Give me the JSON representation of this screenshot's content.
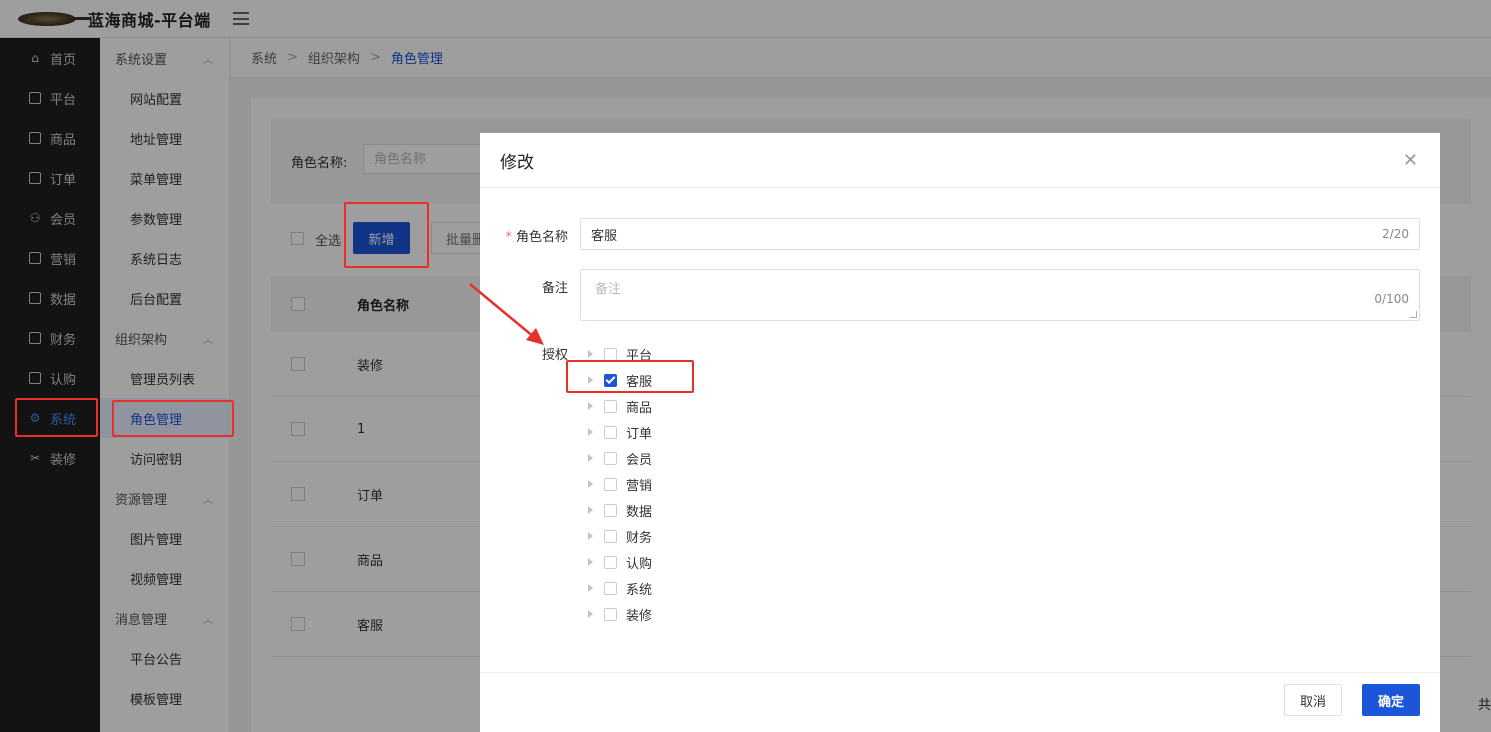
{
  "app": {
    "brand": "蓝海商城-平台端"
  },
  "sidebar": {
    "items": [
      {
        "label": "首页",
        "icon": "home-icon"
      },
      {
        "label": "平台",
        "icon": "monitor-icon"
      },
      {
        "label": "商品",
        "icon": "shop-icon"
      },
      {
        "label": "订单",
        "icon": "order-icon"
      },
      {
        "label": "会员",
        "icon": "users-icon"
      },
      {
        "label": "营销",
        "icon": "gift-icon"
      },
      {
        "label": "数据",
        "icon": "chart-icon"
      },
      {
        "label": "财务",
        "icon": "finance-icon"
      },
      {
        "label": "认购",
        "icon": "subscribe-icon"
      },
      {
        "label": "系统",
        "icon": "gear-icon",
        "active": true
      },
      {
        "label": "装修",
        "icon": "decor-icon"
      }
    ]
  },
  "submenu": {
    "groups": [
      {
        "label": "系统设置",
        "items": [
          "网站配置",
          "地址管理",
          "菜单管理",
          "参数管理",
          "系统日志",
          "后台配置"
        ]
      },
      {
        "label": "组织架构",
        "items": [
          "管理员列表",
          "角色管理",
          "访问密钥"
        ]
      },
      {
        "label": "资源管理",
        "items": [
          "图片管理",
          "视频管理"
        ]
      },
      {
        "label": "消息管理",
        "items": [
          "平台公告",
          "模板管理"
        ]
      }
    ],
    "active_item": "角色管理"
  },
  "breadcrumb": {
    "items": [
      "系统",
      "组织架构",
      "角色管理"
    ]
  },
  "search": {
    "label": "角色名称:",
    "placeholder": "角色名称"
  },
  "toolbar": {
    "select_all": "全选",
    "add_label": "新增",
    "batch_label": "批量删"
  },
  "table": {
    "header": "角色名称",
    "rows": [
      "装修",
      "1",
      "订单",
      "商品",
      "客服"
    ]
  },
  "pagination": {
    "total_prefix": "共"
  },
  "modal": {
    "title": "修改",
    "role_name_label": "角色名称",
    "role_name_value": "客服",
    "role_name_count": "2/20",
    "remark_label": "备注",
    "remark_placeholder": "备注",
    "remark_count": "0/100",
    "auth_label": "授权",
    "permissions": [
      {
        "label": "平台",
        "checked": false
      },
      {
        "label": "客服",
        "checked": true
      },
      {
        "label": "商品",
        "checked": false
      },
      {
        "label": "订单",
        "checked": false
      },
      {
        "label": "会员",
        "checked": false
      },
      {
        "label": "营销",
        "checked": false
      },
      {
        "label": "数据",
        "checked": false
      },
      {
        "label": "财务",
        "checked": false
      },
      {
        "label": "认购",
        "checked": false
      },
      {
        "label": "系统",
        "checked": false
      },
      {
        "label": "装修",
        "checked": false
      }
    ],
    "cancel_label": "取消",
    "confirm_label": "确定"
  },
  "colors": {
    "primary": "#1b55d8",
    "annotation": "#e8302a",
    "sidebar_bg": "#1f1f1f"
  }
}
